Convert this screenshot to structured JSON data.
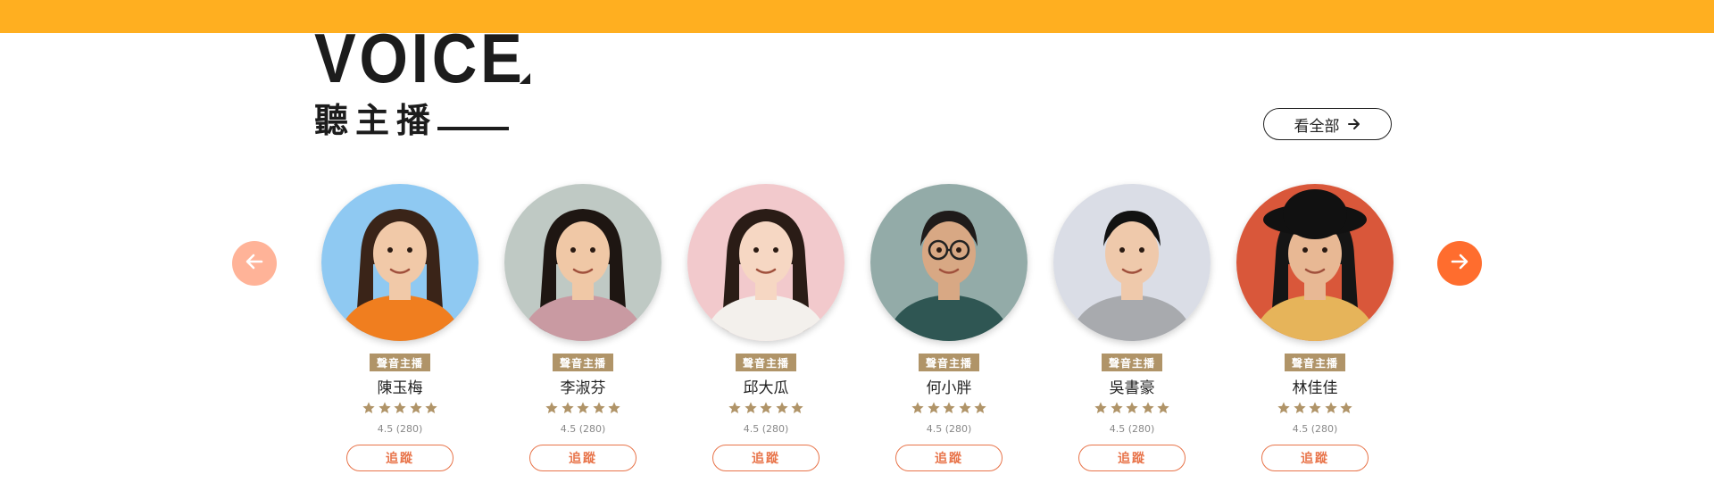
{
  "header": {
    "title_en": "VOICE",
    "title_zh": "聽主播",
    "view_all_label": "看全部"
  },
  "colors": {
    "top_bar": "#FFAF20",
    "badge": "#B09468",
    "follow": "#E8744A",
    "next_arrow": "#FF6D2E",
    "prev_arrow": "#FFB398"
  },
  "hosts": [
    {
      "role": "聲音主播",
      "name": "陳玉梅",
      "rating_text": "4.5 (280)",
      "follow_label": "追蹤",
      "stars": 5,
      "avatar_bg": "#8FC9F2",
      "avatar_icon": "woman-orange-sweater-avatar"
    },
    {
      "role": "聲音主播",
      "name": "李淑芬",
      "rating_text": "4.5 (280)",
      "follow_label": "追蹤",
      "stars": 5,
      "avatar_bg": "#BFC9C4",
      "avatar_icon": "woman-pink-top-avatar"
    },
    {
      "role": "聲音主播",
      "name": "邱大瓜",
      "rating_text": "4.5 (280)",
      "follow_label": "追蹤",
      "stars": 5,
      "avatar_bg": "#F2C9CC",
      "avatar_icon": "woman-white-top-avatar"
    },
    {
      "role": "聲音主播",
      "name": "何小胖",
      "rating_text": "4.5 (280)",
      "follow_label": "追蹤",
      "stars": 5,
      "avatar_bg": "#93ABA8",
      "avatar_icon": "man-glasses-avatar"
    },
    {
      "role": "聲音主播",
      "name": "吳書豪",
      "rating_text": "4.5 (280)",
      "follow_label": "追蹤",
      "stars": 5,
      "avatar_bg": "#DADDE6",
      "avatar_icon": "man-grey-shirt-avatar"
    },
    {
      "role": "聲音主播",
      "name": "林佳佳",
      "rating_text": "4.5 (280)",
      "follow_label": "追蹤",
      "stars": 5,
      "avatar_bg": "#D9573A",
      "avatar_icon": "woman-black-hat-avatar"
    }
  ]
}
